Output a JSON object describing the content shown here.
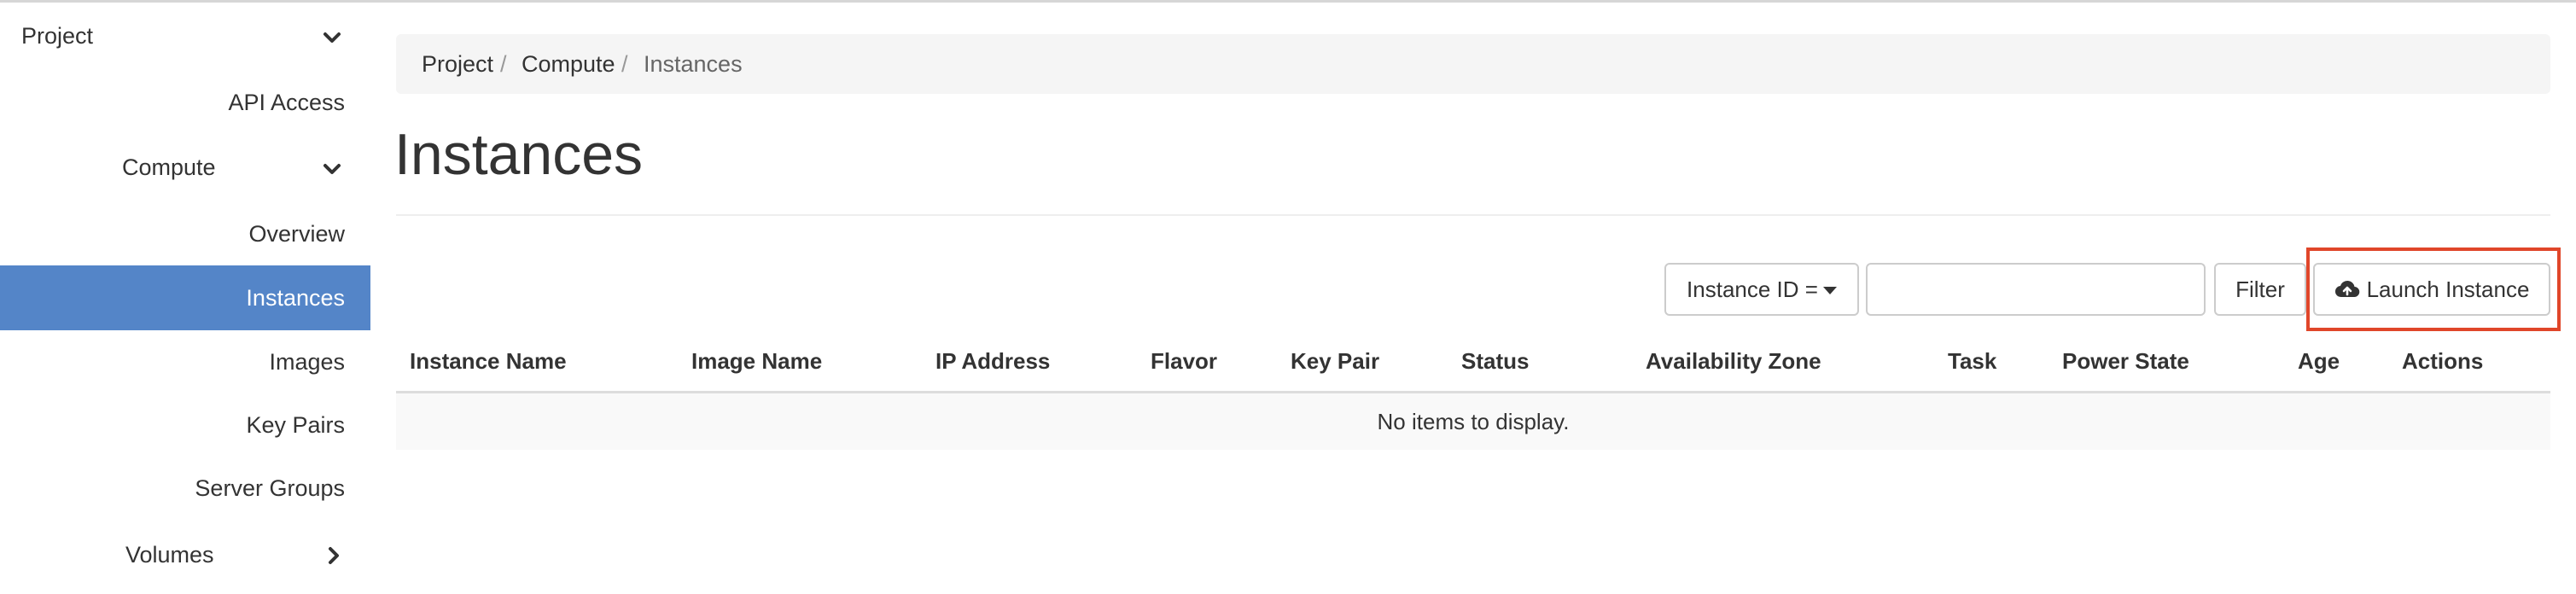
{
  "sidebar": {
    "project_label": "Project",
    "api_access_label": "API Access",
    "compute_label": "Compute",
    "overview_label": "Overview",
    "instances_label": "Instances",
    "images_label": "Images",
    "key_pairs_label": "Key Pairs",
    "server_groups_label": "Server Groups",
    "volumes_label": "Volumes"
  },
  "breadcrumb": {
    "items": [
      "Project",
      "Compute",
      "Instances"
    ],
    "separator": "/"
  },
  "page": {
    "title": "Instances"
  },
  "toolbar": {
    "filter_field_label": "Instance ID =",
    "filter_input_value": "",
    "filter_input_placeholder": "",
    "filter_button_label": "Filter",
    "launch_button_label": "Launch Instance",
    "launch_icon": "cloud-upload-icon"
  },
  "table": {
    "columns": [
      "Instance Name",
      "Image Name",
      "IP Address",
      "Flavor",
      "Key Pair",
      "Status",
      "Availability Zone",
      "Task",
      "Power State",
      "Age",
      "Actions"
    ],
    "empty_message": "No items to display."
  },
  "colors": {
    "active_nav_bg": "#5485c8",
    "highlight_border": "#e0462a",
    "breadcrumb_bg": "#f5f5f5"
  }
}
